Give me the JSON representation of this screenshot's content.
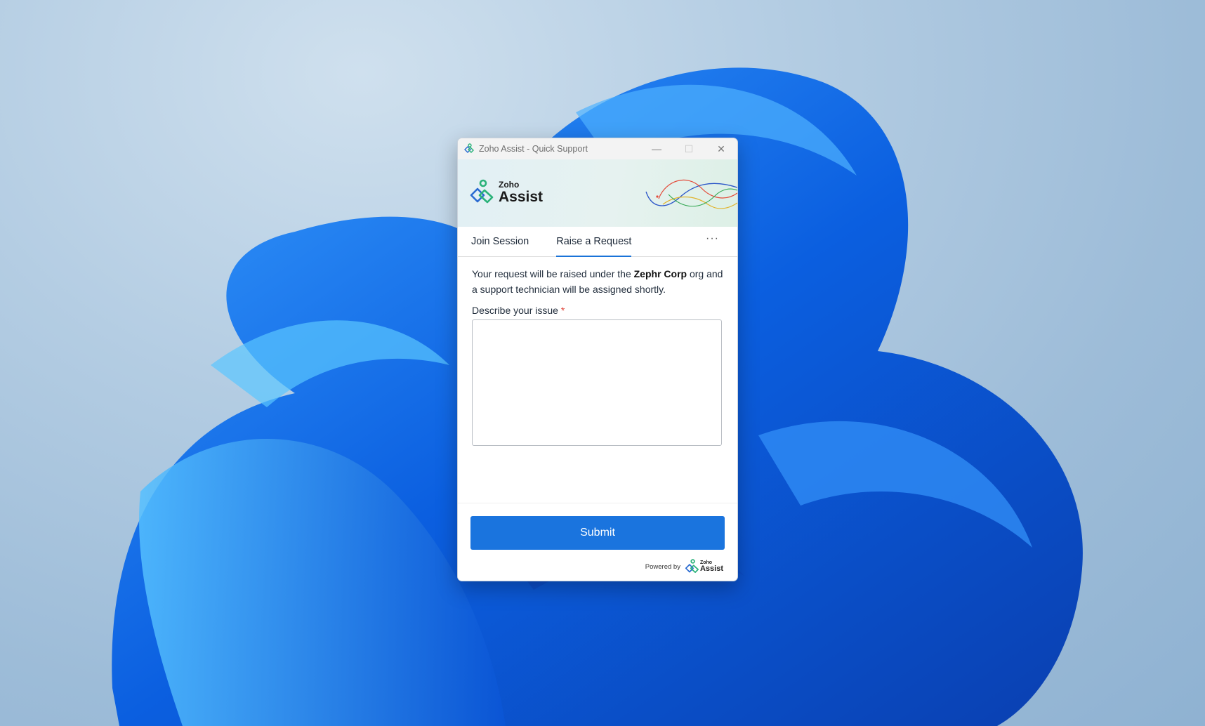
{
  "window": {
    "title": "Zoho Assist - Quick Support",
    "controls": {
      "minimize": "—",
      "maximize": "☐",
      "close": "✕"
    }
  },
  "banner": {
    "brand_small": "Zoho",
    "brand_big": "Assist"
  },
  "tabs": [
    {
      "label": "Join Session",
      "active": false
    },
    {
      "label": "Raise a Request",
      "active": true
    }
  ],
  "more_label": "···",
  "form": {
    "message_prefix": "Your request will be raised under the ",
    "org_name": "Zephr Corp",
    "message_suffix": " org and a support technician will be assigned shortly.",
    "issue_label": "Describe your issue",
    "required_mark": "*",
    "issue_value": "",
    "submit_label": "Submit"
  },
  "footer": {
    "powered_by": "Powered by",
    "brand_small": "Zoho",
    "brand_big": "Assist"
  },
  "icons": {
    "app": "zoho-assist-logo-icon",
    "close": "close-icon",
    "minimize": "minimize-icon",
    "maximize": "maximize-icon",
    "more": "more-options-icon"
  },
  "colors": {
    "accent": "#1a74de",
    "tab_underline": "#1a73d8",
    "required": "#e0453a"
  }
}
